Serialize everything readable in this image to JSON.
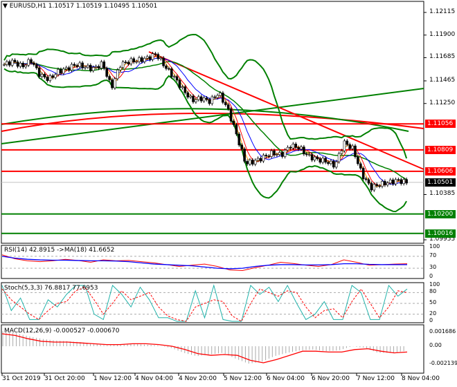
{
  "header": {
    "symbol": "EURUSD,H1",
    "ohlc": "1.10517 1.10519 1.10495 1.10501"
  },
  "price_axis": [
    "1.12115",
    "1.11900",
    "1.11685",
    "1.11465",
    "1.11250",
    "1.10385",
    "1.09955"
  ],
  "levels": [
    {
      "price": 1.11056,
      "label": "1.11056",
      "color": "#ff0000"
    },
    {
      "price": 1.10809,
      "label": "1.10809",
      "color": "#ff0000"
    },
    {
      "price": 1.10606,
      "label": "1.10606",
      "color": "#ff0000"
    },
    {
      "price": 1.102,
      "label": "1.10200",
      "color": "#008000"
    },
    {
      "price": 1.10016,
      "label": "1.10016",
      "color": "#008000"
    }
  ],
  "current_price": {
    "price": 1.10501,
    "label": "1.10501"
  },
  "closes": [
    1.1162,
    1.1165,
    1.116,
    1.1166,
    1.1152,
    1.1148,
    1.1155,
    1.1158,
    1.1162,
    1.116,
    1.1158,
    1.1163,
    1.114,
    1.1162,
    1.1165,
    1.1166,
    1.1168,
    1.1172,
    1.116,
    1.115,
    1.1138,
    1.1128,
    1.113,
    1.1127,
    1.1135,
    1.112,
    1.1095,
    1.1068,
    1.107,
    1.1074,
    1.1078,
    1.1076,
    1.1085,
    1.1083,
    1.1075,
    1.1072,
    1.107,
    1.1066,
    1.1088,
    1.1082,
    1.1058,
    1.1045,
    1.1048,
    1.105,
    1.1052,
    1.105
  ],
  "rsi": {
    "label": "RSI(14) 42.8915  ->MA(18) 41.6652",
    "axis": [
      "100",
      "70",
      "30",
      "0"
    ],
    "values": [
      75,
      62,
      55,
      52,
      55,
      60,
      56,
      50,
      58,
      55,
      56,
      52,
      48,
      42,
      36,
      40,
      44,
      36,
      24,
      22,
      32,
      40,
      50,
      46,
      40,
      36,
      42,
      58,
      50,
      40,
      42,
      44,
      45
    ],
    "ma": [
      70,
      64,
      60,
      58,
      57,
      57,
      56,
      55,
      55,
      54,
      52,
      48,
      44,
      42,
      40,
      38,
      34,
      30,
      28,
      30,
      36,
      40,
      42,
      42,
      41,
      41,
      42,
      45,
      45,
      43,
      42,
      42,
      42
    ]
  },
  "stoch": {
    "label": "Stoch(5,3,3) 76.8817 77.6953",
    "axis": [
      "100",
      "80",
      "50",
      "20",
      "0"
    ],
    "main": [
      100,
      30,
      65,
      5,
      5,
      60,
      40,
      75,
      100,
      100,
      20,
      5,
      100,
      75,
      40,
      95,
      60,
      10,
      10,
      0,
      0,
      85,
      10,
      100,
      5,
      0,
      0,
      100,
      75,
      95,
      55,
      100,
      50,
      5,
      20,
      55,
      5,
      5,
      100,
      80,
      5,
      5,
      100,
      70,
      90
    ],
    "signal": [
      90,
      60,
      40,
      20,
      5,
      30,
      50,
      55,
      85,
      95,
      60,
      20,
      50,
      85,
      60,
      70,
      80,
      40,
      15,
      5,
      0,
      40,
      50,
      60,
      55,
      15,
      0,
      50,
      90,
      80,
      70,
      85,
      80,
      40,
      10,
      30,
      35,
      10,
      55,
      90,
      50,
      10,
      40,
      85,
      80
    ]
  },
  "macd": {
    "label": "MACD(12,26,9) -0.000527 -0.000670",
    "axis": [
      "0.001686",
      "0.00",
      "-0.002139"
    ],
    "hist": [
      0.0018,
      0.0016,
      0.0012,
      0.0009,
      0.0007,
      0.0006,
      0.0005,
      0.0003,
      0.0001,
      0.0002,
      0.0003,
      0.0002,
      0.0001,
      -0.0002,
      -0.0008,
      -0.0012,
      -0.001,
      -0.0008,
      -0.0015,
      -0.0021,
      -0.0019,
      -0.0012,
      -0.0008,
      -0.0005,
      -0.0004,
      -0.0006,
      -0.0005,
      0.0,
      -0.0002,
      -0.0008,
      -0.0008,
      -0.0006
    ],
    "signal": [
      0.0015,
      0.0013,
      0.0009,
      0.0006,
      0.0005,
      0.0005,
      0.0004,
      0.0003,
      0.0002,
      0.0002,
      0.0003,
      0.0003,
      0.0002,
      0.0,
      -0.0004,
      -0.0009,
      -0.0011,
      -0.001,
      -0.0011,
      -0.0017,
      -0.002,
      -0.0016,
      -0.0011,
      -0.0006,
      -0.0006,
      -0.0007,
      -0.0007,
      -0.0004,
      -0.0003,
      -0.0006,
      -0.0008,
      -0.0007
    ]
  },
  "time_axis": [
    "31 Oct 2019",
    "31 Oct 20:00",
    "1 Nov 12:00",
    "4 Nov 04:00",
    "4 Nov 20:00",
    "5 Nov 12:00",
    "6 Nov 04:00",
    "6 Nov 20:00",
    "7 Nov 12:00",
    "8 Nov 04:00"
  ]
}
